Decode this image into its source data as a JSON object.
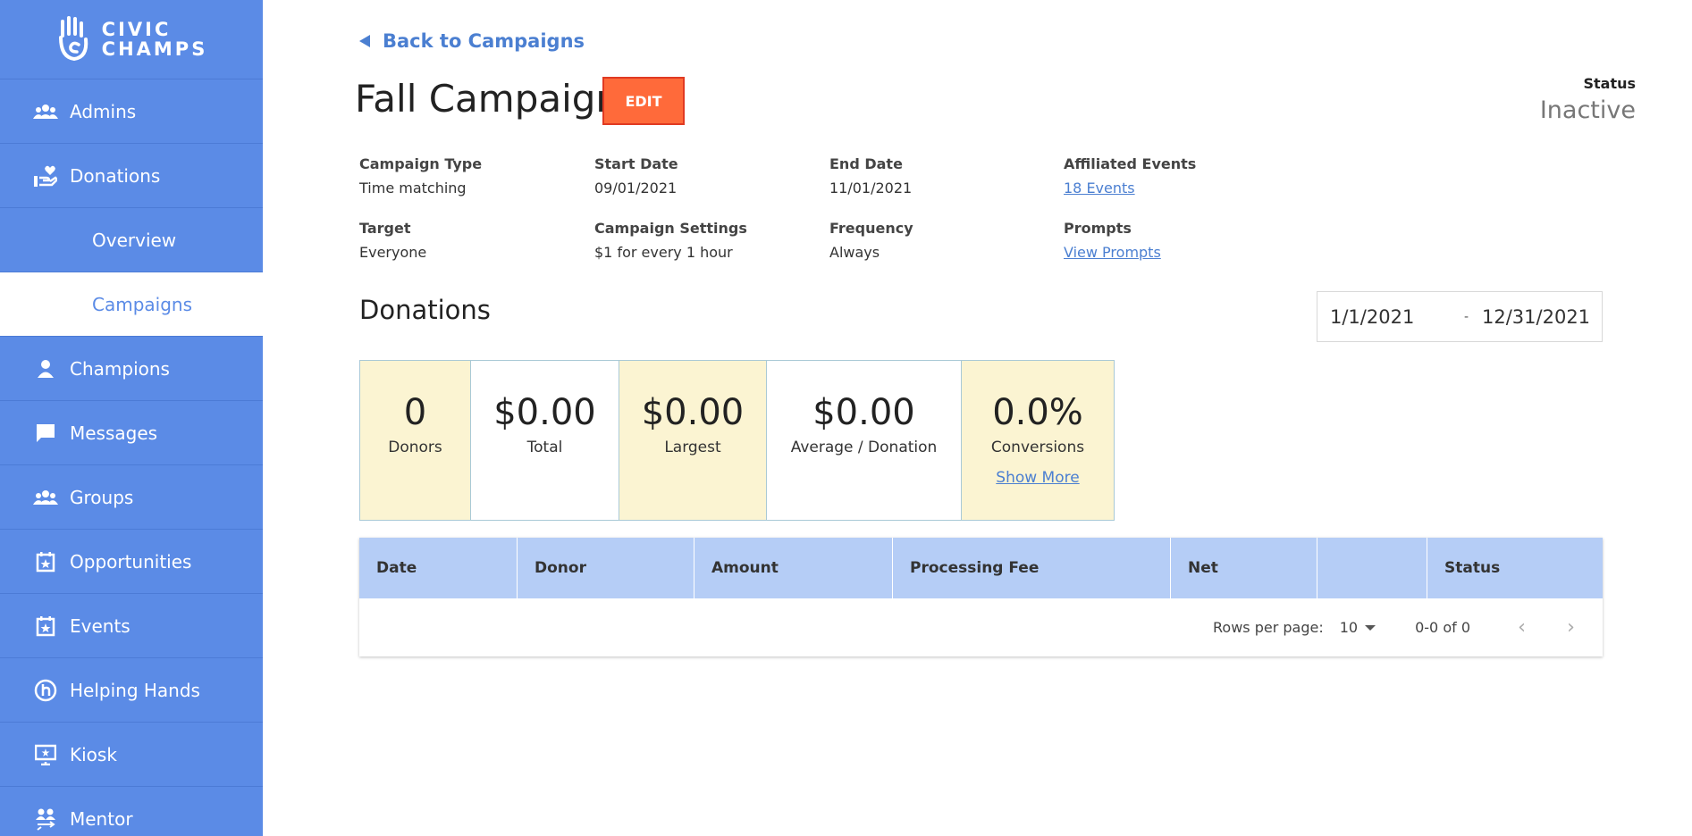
{
  "sidebar": {
    "logo_text_1": "CIVIC",
    "logo_text_2": "CHAMPS",
    "items": [
      {
        "label": "Admins",
        "icon": "group-icon"
      },
      {
        "label": "Donations",
        "icon": "donation-hand-heart-icon"
      },
      {
        "label": "Overview"
      },
      {
        "label": "Campaigns"
      },
      {
        "label": "Champions",
        "icon": "person-icon"
      },
      {
        "label": "Messages",
        "icon": "chat-bubble-icon"
      },
      {
        "label": "Groups",
        "icon": "group-icon"
      },
      {
        "label": "Opportunities",
        "icon": "calendar-star-icon"
      },
      {
        "label": "Events",
        "icon": "calendar-star-icon"
      },
      {
        "label": "Helping Hands",
        "icon": "helping-hands-icon"
      },
      {
        "label": "Kiosk",
        "icon": "kiosk-monitor-icon"
      },
      {
        "label": "Mentor",
        "icon": "mentor-icon"
      }
    ],
    "active": "Campaigns"
  },
  "header": {
    "back_label": "Back to Campaigns",
    "title": "Fall Campaign",
    "edit_label": "EDIT",
    "status_label": "Status",
    "status_value": "Inactive"
  },
  "details": {
    "campaign_type_label": "Campaign Type",
    "campaign_type_value": "Time matching",
    "start_date_label": "Start Date",
    "start_date_value": "09/01/2021",
    "end_date_label": "End Date",
    "end_date_value": "11/01/2021",
    "affiliated_events_label": "Affiliated Events",
    "affiliated_events_value": "18 Events",
    "target_label": "Target",
    "target_value": "Everyone",
    "campaign_settings_label": "Campaign Settings",
    "campaign_settings_value": "$1 for every 1 hour",
    "frequency_label": "Frequency",
    "frequency_value": "Always",
    "prompts_label": "Prompts",
    "prompts_value": "View Prompts"
  },
  "donations": {
    "heading": "Donations",
    "date_from": "1/1/2021",
    "date_sep": "-",
    "date_to": "12/31/2021",
    "stats": [
      {
        "value": "0",
        "caption": "Donors"
      },
      {
        "value": "$0.00",
        "caption": "Total"
      },
      {
        "value": "$0.00",
        "caption": "Largest"
      },
      {
        "value": "$0.00",
        "caption": "Average / Donation"
      },
      {
        "value": "0.0%",
        "caption": "Conversions",
        "link": "Show More"
      }
    ]
  },
  "table": {
    "columns": [
      "Date",
      "Donor",
      "Amount",
      "Processing Fee",
      "Net",
      "",
      "Status"
    ],
    "rows_per_page_label": "Rows per page:",
    "rows_per_page_value": "10",
    "range_text": "0-0 of 0",
    "prev_glyph": "‹",
    "next_glyph": "›"
  },
  "colors": {
    "sidebar": "#5b8be6",
    "accent": "#4b7fd1",
    "edit_button": "#ff6a3a",
    "stat_highlight": "#fbf4d2",
    "table_header": "#b5cdf6"
  }
}
